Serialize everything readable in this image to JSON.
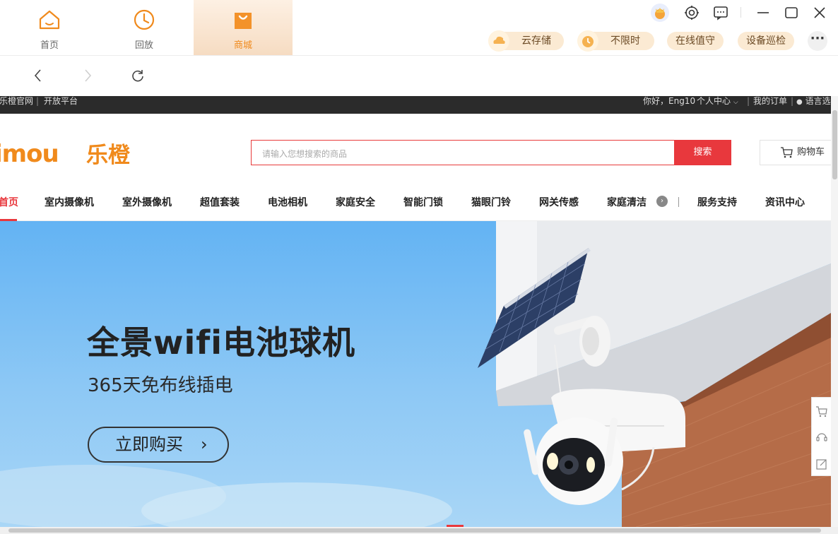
{
  "app": {
    "tabs": [
      {
        "label": "首页",
        "icon": "home-icon"
      },
      {
        "label": "回放",
        "icon": "clock-icon"
      },
      {
        "label": "商城",
        "icon": "shopping-bag-icon"
      }
    ],
    "active_tab": "商城",
    "services": [
      {
        "label": "云存储",
        "icon": "cloud-icon"
      },
      {
        "label": "不限时",
        "icon": "alarm-clock-icon"
      },
      {
        "label": "在线值守"
      },
      {
        "label": "设备巡检"
      }
    ],
    "more_label": "···",
    "accent_color": "#f08a1c"
  },
  "site": {
    "utility": {
      "left_links": [
        "乐橙官网",
        "|",
        "开放平台"
      ],
      "greeting": "你好，Eng10",
      "user_center": "个人中心",
      "orders": "我的订单",
      "language": "语言选"
    },
    "logo_text": "imou",
    "logo_cn": "乐橙",
    "search_placeholder": "请输入您想搜索的商品",
    "search_button": "搜索",
    "cart_label": "购物车",
    "categories": [
      "首页",
      "室内摄像机",
      "室外摄像机",
      "超值套装",
      "电池相机",
      "家庭安全",
      "智能门锁",
      "猫眼门铃",
      "网关传感",
      "家庭清洁"
    ],
    "categories_extra": [
      "服务支持",
      "资讯中心"
    ],
    "brand_red": "#e8383d"
  },
  "banner": {
    "title": "全景wifi电池球机",
    "subtitle": "365天免布线插电",
    "cta": "立即购买",
    "cta_chevron": "›"
  }
}
